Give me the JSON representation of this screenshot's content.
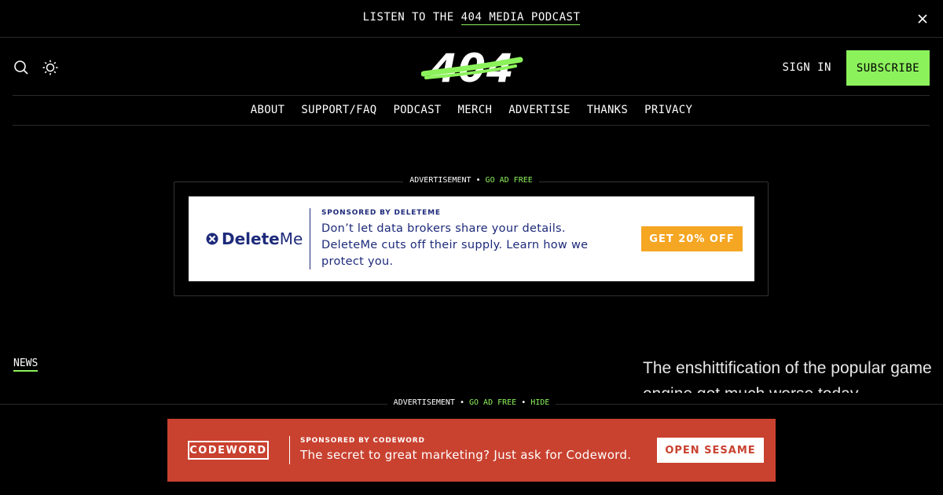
{
  "banner": {
    "prefix": "LISTEN TO THE ",
    "link": "404 MEDIA PODCAST",
    "close_icon": "close-icon"
  },
  "header": {
    "logo": "404",
    "search_icon": "search-icon",
    "theme_icon": "sun-icon",
    "sign_in": "SIGN IN",
    "subscribe": "SUBSCRIBE"
  },
  "nav": {
    "items": [
      "ABOUT",
      "SUPPORT/FAQ",
      "PODCAST",
      "MERCH",
      "ADVERTISE",
      "THANKS",
      "PRIVACY"
    ]
  },
  "ad1": {
    "label": "ADVERTISEMENT",
    "go_ad_free": "GO AD FREE",
    "brand_bold": "Delete",
    "brand_thin": "Me",
    "sponsor": "SPONSORED BY DELETEME",
    "text": "Don’t let data brokers share your details. DeleteMe cuts off their supply. Learn how we protect you.",
    "cta": "GET 20% OFF"
  },
  "content": {
    "tag": "NEWS",
    "teaser": "The enshittification of the popular game engine got much worse today."
  },
  "sticky_ad": {
    "label": "ADVERTISEMENT",
    "go_ad_free": "GO AD FREE",
    "hide": "HIDE",
    "brand": "CODEWORD",
    "sponsor": "SPONSORED BY CODEWORD",
    "text": "The secret to great marketing? Just ask for Codeword.",
    "cta": "OPEN SESAME"
  },
  "colors": {
    "accent_green": "#8cf25c",
    "background": "#000000",
    "deleteme_navy": "#1d2a7a",
    "deleteme_orange": "#f5a623",
    "codeword_red": "#c9412f"
  }
}
